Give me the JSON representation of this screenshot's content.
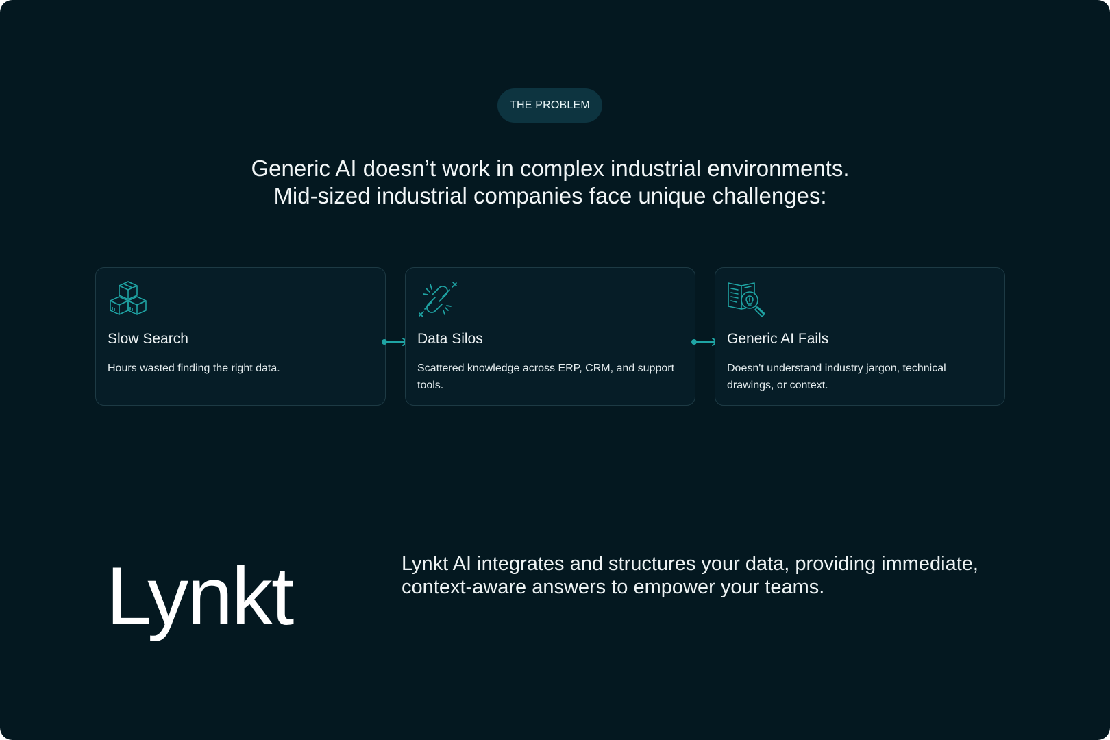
{
  "section": {
    "eyebrow": "THE PROBLEM",
    "headline_line1": "Generic AI doesn’t work in complex industrial environments.",
    "headline_line2": "Mid-sized industrial companies face unique challenges:"
  },
  "cards": [
    {
      "icon": "boxes-icon",
      "title": "Slow Search",
      "description": "Hours wasted finding the right data."
    },
    {
      "icon": "broken-link-icon",
      "title": "Data Silos",
      "description": "Scattered knowledge across ERP, CRM, and support tools."
    },
    {
      "icon": "book-bulb-search-icon",
      "title": "Generic AI Fails",
      "description": "Doesn't understand industry jargon, technical drawings, or context."
    }
  ],
  "brand": {
    "wordmark": "Lynkt",
    "tagline_line1": "Lynkt AI integrates and structures your data, providing immediate,",
    "tagline_line2": "context-aware answers to empower your teams."
  },
  "colors": {
    "background": "#041820",
    "card_background": "#061d27",
    "card_border": "#1d3a44",
    "accent": "#1fa4a4",
    "eyebrow_pill": "#0d3440",
    "text": "#ffffff"
  }
}
